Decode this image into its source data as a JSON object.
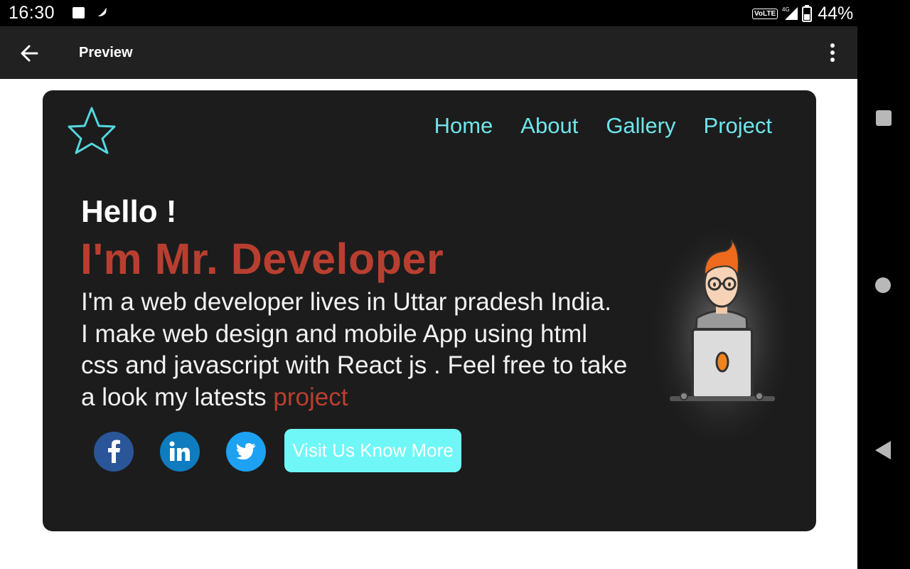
{
  "status_bar": {
    "time": "16:30",
    "network": "VoLTE",
    "signal": "4G",
    "battery": "44%"
  },
  "app_bar": {
    "title": "Preview"
  },
  "page": {
    "nav": [
      "Home",
      "About",
      "Gallery",
      "Project"
    ],
    "greeting": "Hello !",
    "headline": "I'm Mr. Developer",
    "bio_lines": [
      "I'm a web developer lives in Uttar pradesh India.",
      "I make web design and mobile App using html",
      "css and javascript with React js . Feel free to take",
      "a look my latests"
    ],
    "bio_link": "project",
    "cta": "Visit Us Know More",
    "colors": {
      "accent": "#6fe5ea",
      "headline": "#b83f30",
      "card_bg": "#1c1c1c",
      "cta_bg": "#6ff7f7"
    }
  }
}
